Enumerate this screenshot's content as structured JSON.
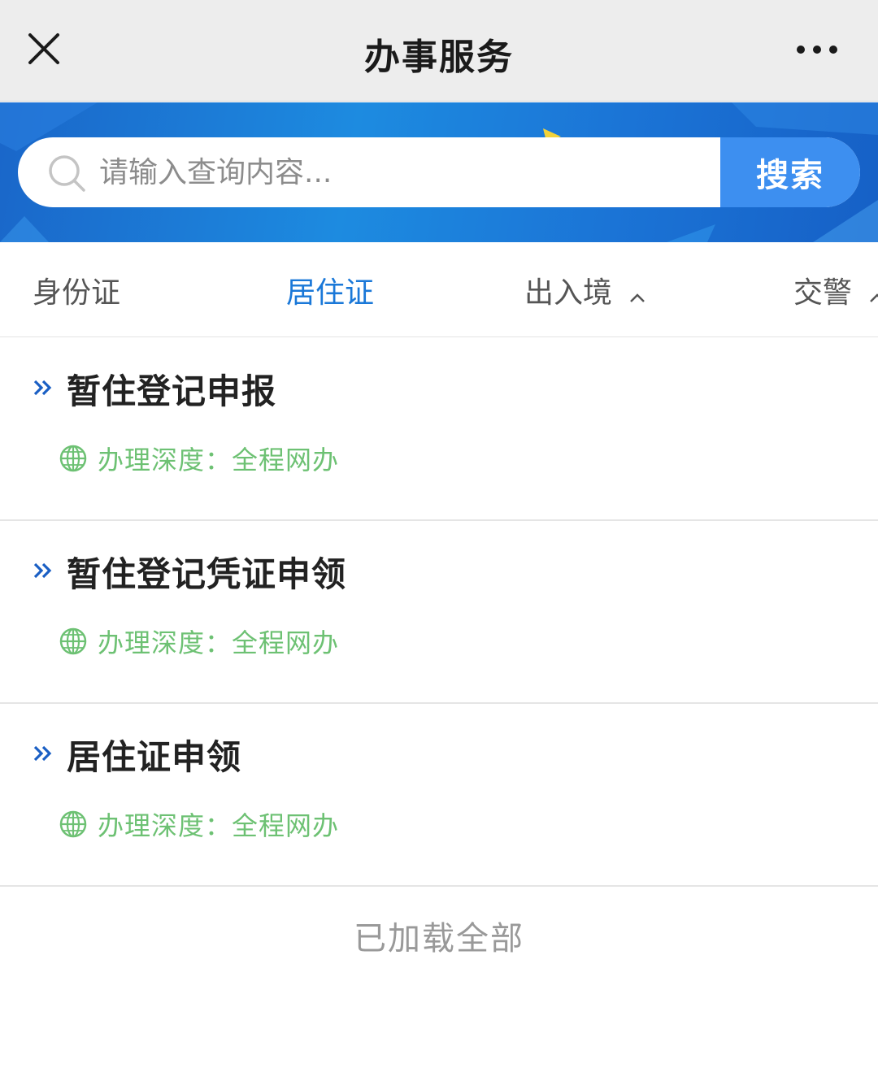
{
  "header": {
    "title": "办事服务",
    "close_icon": "close-icon",
    "more_icon": "more-icon"
  },
  "search": {
    "placeholder": "请输入查询内容...",
    "button_label": "搜索",
    "icon": "search-icon"
  },
  "tabs": [
    {
      "label": "身份证",
      "active": false,
      "has_chevron": false
    },
    {
      "label": "居住证",
      "active": true,
      "has_chevron": false
    },
    {
      "label": "出入境",
      "active": false,
      "has_chevron": true
    },
    {
      "label": "交警",
      "active": false,
      "has_chevron": true
    }
  ],
  "items": [
    {
      "title": "暂住登记申报",
      "depth": "办理深度：全程网办"
    },
    {
      "title": "暂住登记凭证申领",
      "depth": "办理深度：全程网办"
    },
    {
      "title": "居住证申领",
      "depth": "办理深度：全程网办"
    }
  ],
  "footer": {
    "status": "已加载全部"
  },
  "colors": {
    "active_tab": "#1a78d8",
    "depth_green": "#6dc173",
    "search_button": "#3d8ff0",
    "banner_blue": "#1d8be0"
  }
}
